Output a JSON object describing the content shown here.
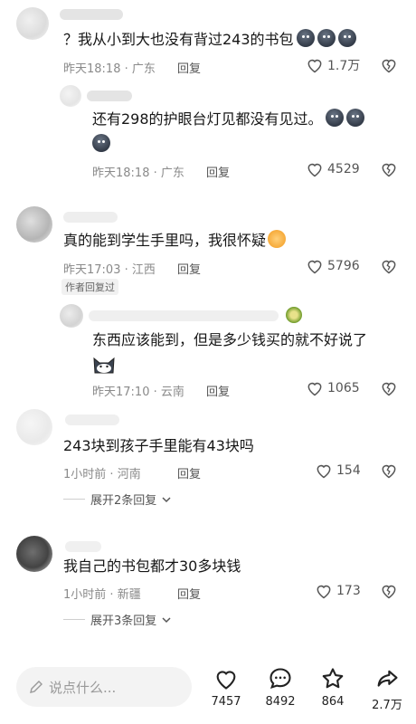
{
  "comments": [
    {
      "text": "？我从小到大也没有背过243的书包",
      "time": "昨天18:18",
      "location": "广东",
      "reply": "回复",
      "likes": "1.7万"
    },
    {
      "text_line1": "还有298的护眼台灯见都没有见过。",
      "time": "昨天18:18",
      "location": "广东",
      "reply": "回复",
      "likes": "4529"
    },
    {
      "text": "真的能到学生手里吗，我很怀疑",
      "time": "昨天17:03",
      "location": "江西",
      "reply": "回复",
      "likes": "5796",
      "badge": "作者回复过"
    },
    {
      "text": "东西应该能到，但是多少钱买的就不好说了",
      "time": "昨天17:10",
      "location": "云南",
      "reply": "回复",
      "likes": "1065"
    },
    {
      "text": "243块到孩子手里能有43块吗",
      "time": "1小时前",
      "location": "河南",
      "reply": "回复",
      "likes": "154",
      "expand": "展开2条回复"
    },
    {
      "text": "我自己的书包都才30多块钱",
      "time": "1小时前",
      "location": "新疆",
      "reply": "回复",
      "likes": "173",
      "expand": "展开3条回复"
    }
  ],
  "bottom_bar": {
    "input_placeholder": "说点什么...",
    "likes": "7457",
    "comments": "8492",
    "favorites": "864",
    "shares": "2.7万"
  },
  "icons": {
    "like": "heart-outline-icon",
    "dislike": "broken-heart-icon",
    "comment": "comment-bubble-icon",
    "favorite": "star-icon",
    "share": "share-arrow-icon",
    "edit": "pencil-icon",
    "expand": "chevron-down-icon"
  },
  "colors": {
    "meta": "#8a8a8a",
    "text": "#161616",
    "pill": "#f3f3f3"
  }
}
